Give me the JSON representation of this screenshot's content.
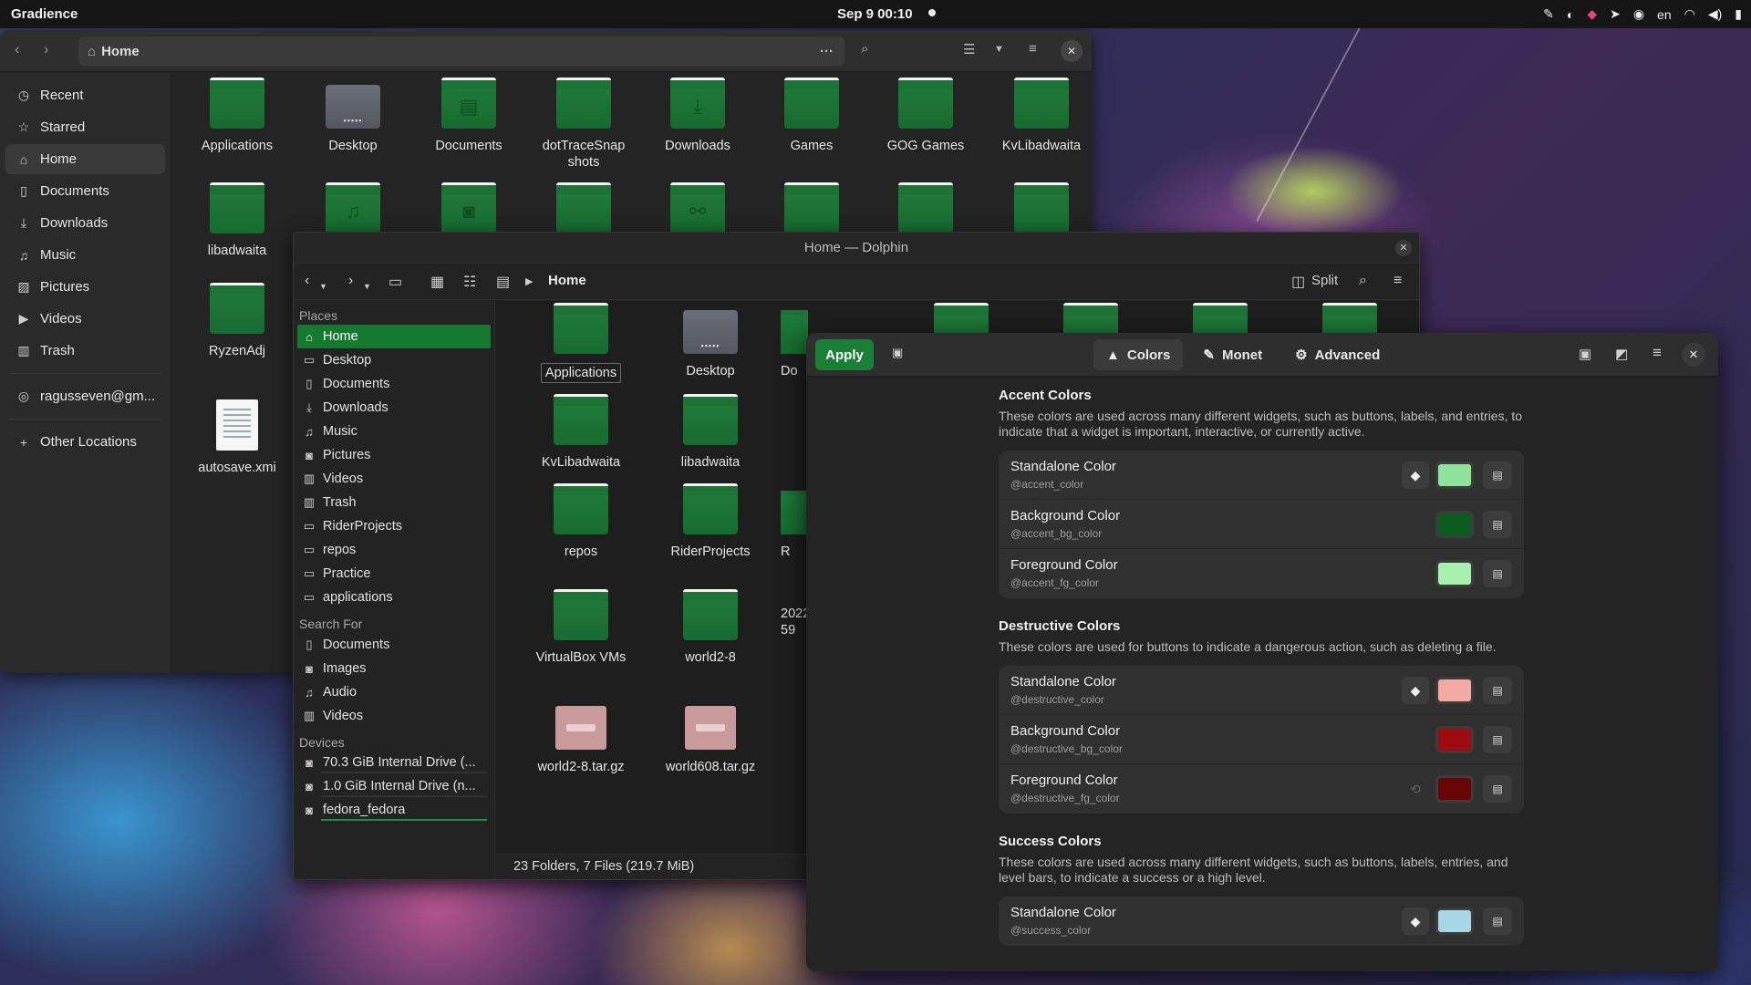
{
  "topbar": {
    "app_name": "Gradience",
    "clock": "Sep 9  00:10",
    "language": "en"
  },
  "nautilus": {
    "path": "Home",
    "sidebar": [
      {
        "label": "Recent",
        "icon": "clock-icon"
      },
      {
        "label": "Starred",
        "icon": "star-icon"
      },
      {
        "label": "Home",
        "icon": "home-icon"
      },
      {
        "label": "Documents",
        "icon": "document-icon"
      },
      {
        "label": "Downloads",
        "icon": "download-icon"
      },
      {
        "label": "Music",
        "icon": "music-icon"
      },
      {
        "label": "Pictures",
        "icon": "picture-icon"
      },
      {
        "label": "Videos",
        "icon": "video-icon"
      },
      {
        "label": "Trash",
        "icon": "trash-icon"
      }
    ],
    "account": "ragusseven@gm...",
    "other_locations": "Other Locations",
    "files": [
      {
        "label": "Applications"
      },
      {
        "label": "Desktop"
      },
      {
        "label": "Documents"
      },
      {
        "label": "dotTraceSnap\nshots"
      },
      {
        "label": "Downloads"
      },
      {
        "label": "Games"
      },
      {
        "label": "GOG Games"
      },
      {
        "label": "KvLibadwaita"
      },
      {
        "label": "libadwaita"
      },
      {
        "label": "RyzenAdj"
      },
      {
        "label": "autosave.xmi"
      }
    ]
  },
  "dolphin": {
    "title": "Home — Dolphin",
    "breadcrumb": "Home",
    "split_label": "Split",
    "sections": {
      "places": "Places",
      "search": "Search For",
      "devices": "Devices"
    },
    "places": [
      "Home",
      "Desktop",
      "Documents",
      "Downloads",
      "Music",
      "Pictures",
      "Videos",
      "Trash",
      "RiderProjects",
      "repos",
      "Practice",
      "applications"
    ],
    "search_for": [
      "Documents",
      "Images",
      "Audio",
      "Videos"
    ],
    "devices": [
      "70.3 GiB Internal Drive (...",
      "1.0 GiB Internal Drive (n...",
      "fedora_fedora"
    ],
    "files": [
      {
        "label": "Applications"
      },
      {
        "label": "Desktop"
      },
      {
        "label": "Do"
      },
      {
        "label": "KvLibadwaita"
      },
      {
        "label": "libadwaita"
      },
      {
        "label": "repos"
      },
      {
        "label": "RiderProjects"
      },
      {
        "label": "R"
      },
      {
        "label": "VirtualBox VMs"
      },
      {
        "label": "world2-8"
      },
      {
        "label": "2022"
      },
      {
        "label": "59"
      },
      {
        "label": "world2-8.tar.gz"
      },
      {
        "label": "world608.tar.gz"
      }
    ],
    "status": "23 Folders, 7 Files (219.7 MiB)"
  },
  "gradience": {
    "apply_label": "Apply",
    "tabs": [
      {
        "label": "Colors",
        "icon": "palette-icon"
      },
      {
        "label": "Monet",
        "icon": "brush-icon"
      },
      {
        "label": "Advanced",
        "icon": "gear-icon"
      }
    ],
    "groups": [
      {
        "title": "Accent Colors",
        "desc": "These colors are used across many different widgets, such as buttons, labels, and entries, to indicate that a widget is important, interactive, or currently active.",
        "rows": [
          {
            "title": "Standalone Color",
            "var": "@accent_color",
            "color": "#8ee39c",
            "reset": true
          },
          {
            "title": "Background Color",
            "var": "@accent_bg_color",
            "color": "#0b5a1e",
            "reset": false
          },
          {
            "title": "Foreground Color",
            "var": "@accent_fg_color",
            "color": "#a8f0ad",
            "reset": false
          }
        ]
      },
      {
        "title": "Destructive Colors",
        "desc": "These colors are used for buttons to indicate a dangerous action, such as deleting a file.",
        "rows": [
          {
            "title": "Standalone Color",
            "var": "@destructive_color",
            "color": "#f4aaa2",
            "reset": true
          },
          {
            "title": "Background Color",
            "var": "@destructive_bg_color",
            "color": "#9d0a0f",
            "reset": false
          },
          {
            "title": "Foreground Color",
            "var": "@destructive_fg_color",
            "color": "#690507",
            "reset": "ghost"
          }
        ]
      },
      {
        "title": "Success Colors",
        "desc": "These colors are used across many different widgets, such as buttons, labels, entries, and level bars, to indicate a success or a high level.",
        "rows": [
          {
            "title": "Standalone Color",
            "var": "@success_color",
            "color": "#a7d6e4",
            "reset": true
          }
        ]
      }
    ]
  }
}
